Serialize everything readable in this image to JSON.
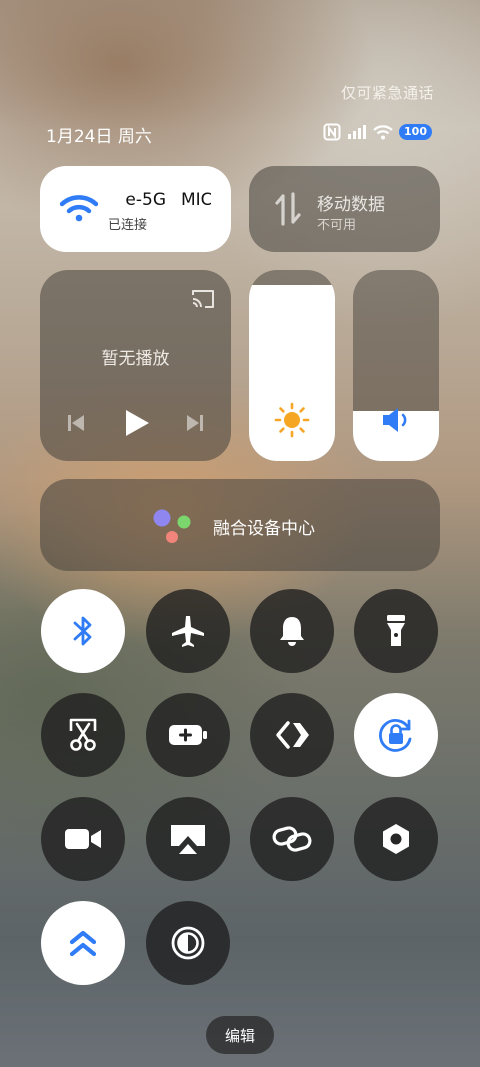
{
  "status_bar": {
    "emergency_text": "仅可紧急通话",
    "date": "1月24日 周六",
    "battery": "100"
  },
  "wifi": {
    "network_name_left": "e-5G",
    "network_name_right": "MIC",
    "status": "已连接"
  },
  "mobile_data": {
    "title": "移动数据",
    "status": "不可用"
  },
  "media": {
    "status": "暂无播放"
  },
  "sliders": {
    "brightness_level": 0.92,
    "volume_level": 0.26
  },
  "device_hub": {
    "label": "融合设备中心"
  },
  "toggles": [
    {
      "id": "bluetooth",
      "icon": "bluetooth-icon",
      "on": true
    },
    {
      "id": "airplane",
      "icon": "airplane-icon",
      "on": false
    },
    {
      "id": "ringer",
      "icon": "bell-icon",
      "on": false
    },
    {
      "id": "flashlight",
      "icon": "flashlight-icon",
      "on": false
    },
    {
      "id": "screenshot",
      "icon": "scissors-icon",
      "on": false
    },
    {
      "id": "battery-saver",
      "icon": "battery-plus-icon",
      "on": false
    },
    {
      "id": "nearby-share",
      "icon": "share-arrows-icon",
      "on": false
    },
    {
      "id": "rotation-lock",
      "icon": "rotation-lock-icon",
      "on": true
    },
    {
      "id": "screen-record",
      "icon": "video-camera-icon",
      "on": false
    },
    {
      "id": "cast-screen",
      "icon": "airplay-icon",
      "on": false
    },
    {
      "id": "link",
      "icon": "link-icon",
      "on": false
    },
    {
      "id": "settings-hex",
      "icon": "hex-nut-icon",
      "on": false
    },
    {
      "id": "performance",
      "icon": "double-chevron-up-icon",
      "on": true
    },
    {
      "id": "dark-mode",
      "icon": "contrast-icon",
      "on": false
    }
  ],
  "edit_button": {
    "label": "编辑"
  },
  "colors": {
    "accent_blue": "#2f7cf6",
    "sun_orange": "#f5a623"
  }
}
